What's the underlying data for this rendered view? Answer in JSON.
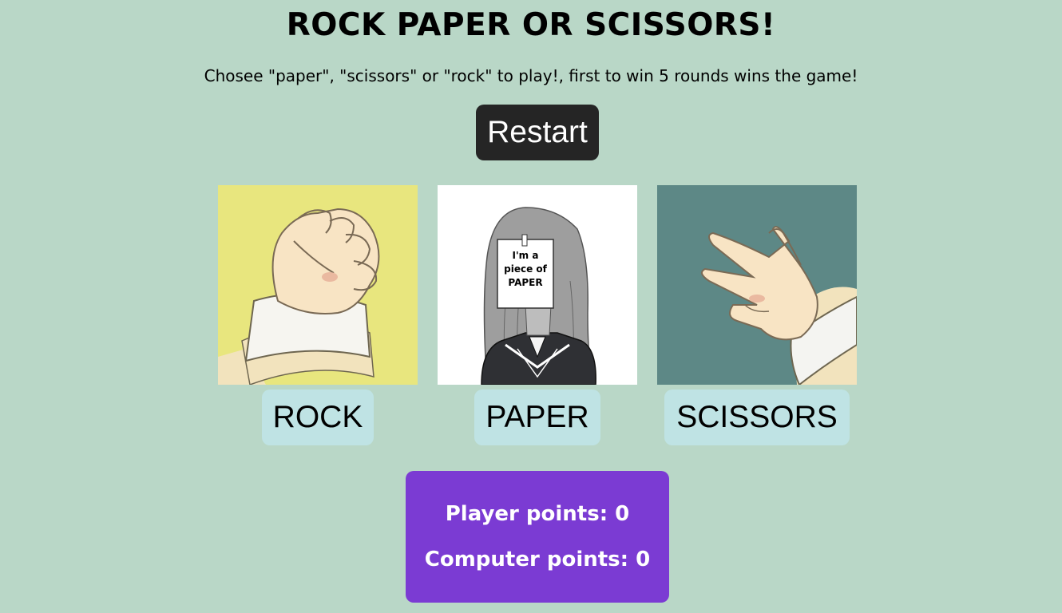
{
  "title": "ROCK PAPER OR SCISSORS!",
  "instructions": "Chosee \"paper\", \"scissors\" or \"rock\" to play!, first to win 5 rounds wins the game!",
  "restart_label": "Restart",
  "choices": [
    {
      "label": "ROCK",
      "image": "fist-icon"
    },
    {
      "label": "PAPER",
      "image": "paper-girl-image",
      "note_lines": [
        "I'm a",
        "piece of",
        "PAPER"
      ]
    },
    {
      "label": "SCISSORS",
      "image": "scissors-hand-icon"
    }
  ],
  "score": {
    "player_label": "Player points:",
    "player_points": "0",
    "computer_label": "Computer points:",
    "computer_points": "0"
  },
  "colors": {
    "background": "#b9d7c7",
    "restart_button": "#252525",
    "choice_button": "#bfe3e4",
    "score_panel": "#7b3bd3",
    "rock_bg": "#e8e67e",
    "scissors_bg": "#5d8886"
  }
}
